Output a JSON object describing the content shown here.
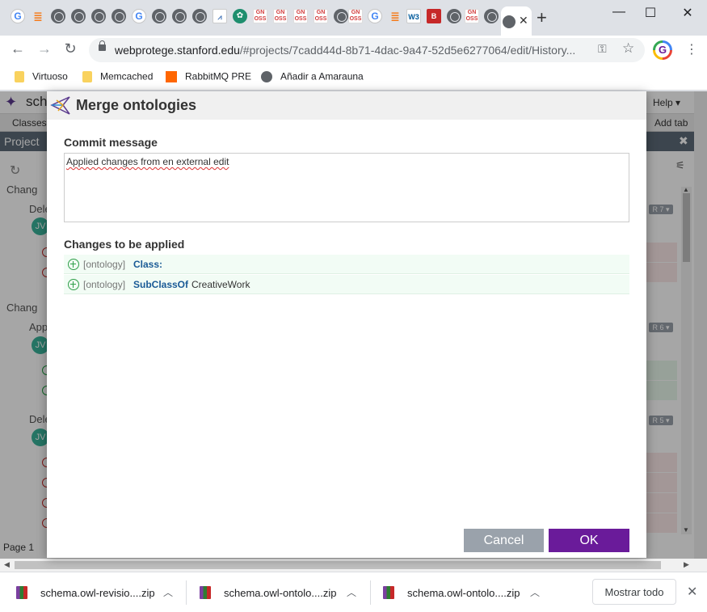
{
  "browser": {
    "active_tab_close": "✕",
    "new_tab": "+",
    "window": {
      "minimize": "—",
      "maximize": "☐",
      "close": "✕"
    },
    "url_host": "webprotege.stanford.edu",
    "url_path": "/#projects/7cadd44d-8b71-4dac-9a47-52d5e6277064/edit/History...",
    "nav": {
      "back": "←",
      "forward": "→",
      "reload": "↻"
    },
    "profile_letter": "G"
  },
  "bookmarks": [
    {
      "label": "Virtuoso",
      "icon": "folder-icon"
    },
    {
      "label": "Memcached",
      "icon": "folder-icon"
    },
    {
      "label": "RabbitMQ PRE",
      "icon": "rabbitmq-icon"
    },
    {
      "label": "Añadir a Amarauna",
      "icon": "globe-icon"
    }
  ],
  "webprotege": {
    "title": "sch",
    "help": "Help ▾",
    "tab_classes": "Classes",
    "tab_add": "Add tab",
    "panel_title": "Project",
    "rows": [
      "Chang",
      "Dele",
      "Chang",
      "App",
      "Dele"
    ],
    "badge": "JV",
    "revisions": [
      "R 7 ▾",
      "R 6 ▾",
      "R 5 ▾"
    ],
    "page_label": "Page  1"
  },
  "dialog": {
    "title": "Merge ontologies",
    "commit_label": "Commit message",
    "commit_value": "Applied changes from en external edit",
    "changes_label": "Changes to be applied",
    "changes": [
      {
        "ontology": "[ontology]",
        "keyword": "Class:",
        "value": ""
      },
      {
        "ontology": "[ontology]",
        "keyword": "SubClassOf",
        "value": "CreativeWork"
      }
    ],
    "cancel_label": "Cancel",
    "ok_label": "OK"
  },
  "downloads": {
    "items": [
      {
        "name": "schema.owl-revisio....zip"
      },
      {
        "name": "schema.owl-ontolo....zip"
      },
      {
        "name": "schema.owl-ontolo....zip"
      }
    ],
    "show_all": "Mostrar todo",
    "close": "✕"
  },
  "colors": {
    "accent": "#6a1b9a",
    "cancel": "#9aa2ab",
    "change_row_bg": "#f2fcf5",
    "keyword": "#1a5a96"
  }
}
